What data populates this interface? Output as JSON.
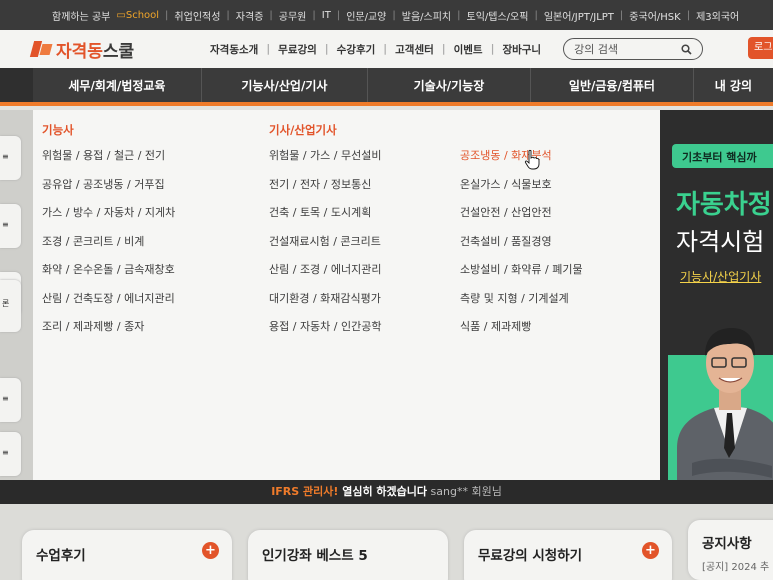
{
  "topbar": {
    "items": [
      "함께하는 공부",
      "취업인적성",
      "자격증",
      "공무원",
      "IT",
      "인문/교양",
      "발음/스피치",
      "토익/텝스/오픽",
      "일본어/JPT/JLPT",
      "중국어/HSK",
      "제3외국어"
    ],
    "school_label": "School"
  },
  "header": {
    "logo_text": "자격동",
    "logo_text2": "스쿨",
    "nav": [
      "자격동소개",
      "무료강의",
      "수강후기",
      "고객센터",
      "이벤트",
      "장바구니"
    ],
    "search_placeholder": "강의 검색",
    "login_label": "로그"
  },
  "categories": [
    "세무/회계/법정교육",
    "기능사/산업/기사",
    "기술사/기능장",
    "일반/금융/컴퓨터",
    "내 강의"
  ],
  "mega_menu": {
    "col1": {
      "head": "기능사",
      "items": [
        "위험물 / 용접 / 철근 / 전기",
        "공유압 / 공조냉동 / 거푸집",
        "가스 / 방수 / 자동차 / 지게차",
        "조경 / 콘크리트 / 비계",
        "화약 / 온수온돌 / 금속재창호",
        "산림 / 건축도장 / 에너지관리",
        "조리 / 제과제빵 / 종자"
      ]
    },
    "col2": {
      "head": "기사/산업기사",
      "items": [
        "위험물 / 가스 / 무선설비",
        "전기 / 전자 / 정보통신",
        "건축 / 토목 / 도시계획",
        "건설재료시험 / 콘크리트",
        "산림 / 조경 / 에너지관리",
        "대기환경 / 화재감식평가",
        "용접 / 자동차 / 인간공학"
      ]
    },
    "col3": {
      "items": [
        "공조냉동 / 화재분석",
        "온실가스 / 식물보호",
        "건설안전 / 산업안전",
        "건축설비 / 품질경영",
        "소방설비 / 화약류 / 폐기물",
        "측량 및 지형 / 기계설계",
        "식품 / 제과제빵"
      ]
    }
  },
  "banner": {
    "pill": "기초부터 핵심까",
    "line1": "자동차정",
    "line2": "자격시험",
    "line3": "기능사/산업기사"
  },
  "notice": {
    "part1": "IFRS 관리사!",
    "part2": " 열심히 하겠습니다",
    "part3": " sang** 회원님"
  },
  "cards": {
    "review": "수업후기",
    "best": "인기강좌 베스트 5",
    "free": "무료강의 시청하기",
    "notice_title": "공지사항",
    "notice_item": "[공지] 2024 추"
  },
  "sidebar_tab_text": "론",
  "colors": {
    "accent": "#e2542a",
    "orange_line": "#ef7b2a",
    "green": "#3ec98f",
    "dark": "#3b3b3b"
  }
}
